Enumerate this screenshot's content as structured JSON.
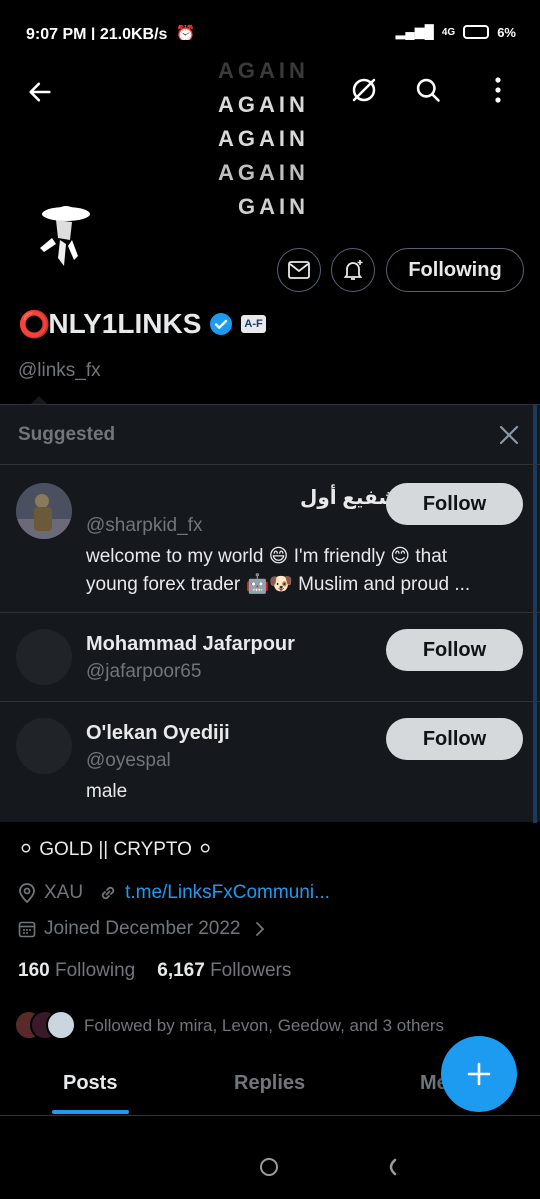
{
  "status": {
    "time_speed": "9:07 PM | 21.0KB/s",
    "network": "4G",
    "battery": "6%"
  },
  "banner": {
    "lines": [
      "AGAIN",
      "AGAIN",
      "AGAIN",
      "AGAIN",
      "GAIN"
    ]
  },
  "profile": {
    "name": "NLY1LINKS",
    "name_prefix_emoji": "⭕",
    "badge": "A-F",
    "handle": "@links_fx",
    "following_button": "Following",
    "bio": "⚪ GOLD || CRYPTO ⚪",
    "location": "XAU",
    "link": "t.me/LinksFxCommuni...",
    "joined": "Joined December 2022",
    "following_count": "160",
    "following_label": "Following",
    "followers_count": "6,167",
    "followers_label": "Followers",
    "followed_by": "Followed by mira, Levon, Geedow, and 3 others"
  },
  "suggested": {
    "title": "Suggested",
    "items": [
      {
        "name": "شفيع أول",
        "handle": "@sharpkid_fx",
        "bio_line1": "welcome to my world 😄 I'm friendly 😊 that",
        "bio_line2": "young forex trader 🤖🐶 Muslim and proud ...",
        "button": "Follow"
      },
      {
        "name": "Mohammad Jafarpour",
        "handle": "@jafarpoor65",
        "button": "Follow"
      },
      {
        "name": "O'lekan Oyediji",
        "handle": "@oyespal",
        "bio_line1": "male",
        "button": "Follow"
      }
    ]
  },
  "tabs": [
    "Posts",
    "Replies",
    "Me"
  ],
  "colors": {
    "accent": "#1d9bf0",
    "verified": "#1d9bf0",
    "background": "#000000"
  }
}
